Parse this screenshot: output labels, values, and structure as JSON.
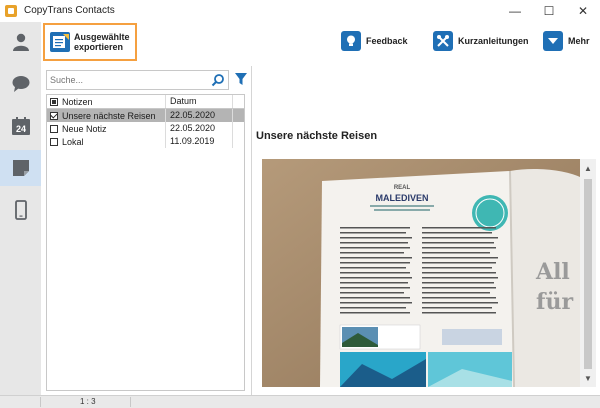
{
  "window": {
    "title": "CopyTrans Contacts",
    "minimize": "—",
    "maximize": "☐",
    "close": "✕"
  },
  "sidebar": {
    "items": [
      {
        "name": "contacts",
        "icon": "person-icon",
        "active": false
      },
      {
        "name": "messages",
        "icon": "chat-bubble-icon",
        "active": false
      },
      {
        "name": "calendar",
        "icon": "calendar-icon",
        "label": "24",
        "active": false
      },
      {
        "name": "notes",
        "icon": "sticky-note-icon",
        "active": true
      },
      {
        "name": "device",
        "icon": "phone-icon",
        "active": false
      }
    ]
  },
  "toolbar": {
    "export_label": "Ausgewählte exportieren",
    "feedback_label": "Feedback",
    "guides_label": "Kurzanleitungen",
    "more_label": "Mehr"
  },
  "search": {
    "placeholder": "Suche..."
  },
  "table": {
    "headers": {
      "notes": "Notizen",
      "date": "Datum"
    },
    "rows": [
      {
        "title": "Unsere nächste Reisen",
        "date": "22.05.2020",
        "checked": true,
        "selected": true
      },
      {
        "title": "Neue Notiz",
        "date": "22.05.2020",
        "checked": false,
        "selected": false
      },
      {
        "title": "Lokal",
        "date": "11.09.2019",
        "checked": false,
        "selected": false
      }
    ]
  },
  "detail": {
    "title": "Unsere nächste Reisen",
    "image_text": {
      "magazine_header": "REAL",
      "article_title": "MALEDIVEN",
      "big_letters_1": "All",
      "big_letters_2": "für"
    }
  },
  "status": {
    "count": "1 : 3"
  },
  "colors": {
    "accent_blue": "#1f6fb5",
    "export_highlight": "#f5a040",
    "sidebar_bg": "#e7e7e7",
    "selected_row": "#b4b4b4"
  }
}
